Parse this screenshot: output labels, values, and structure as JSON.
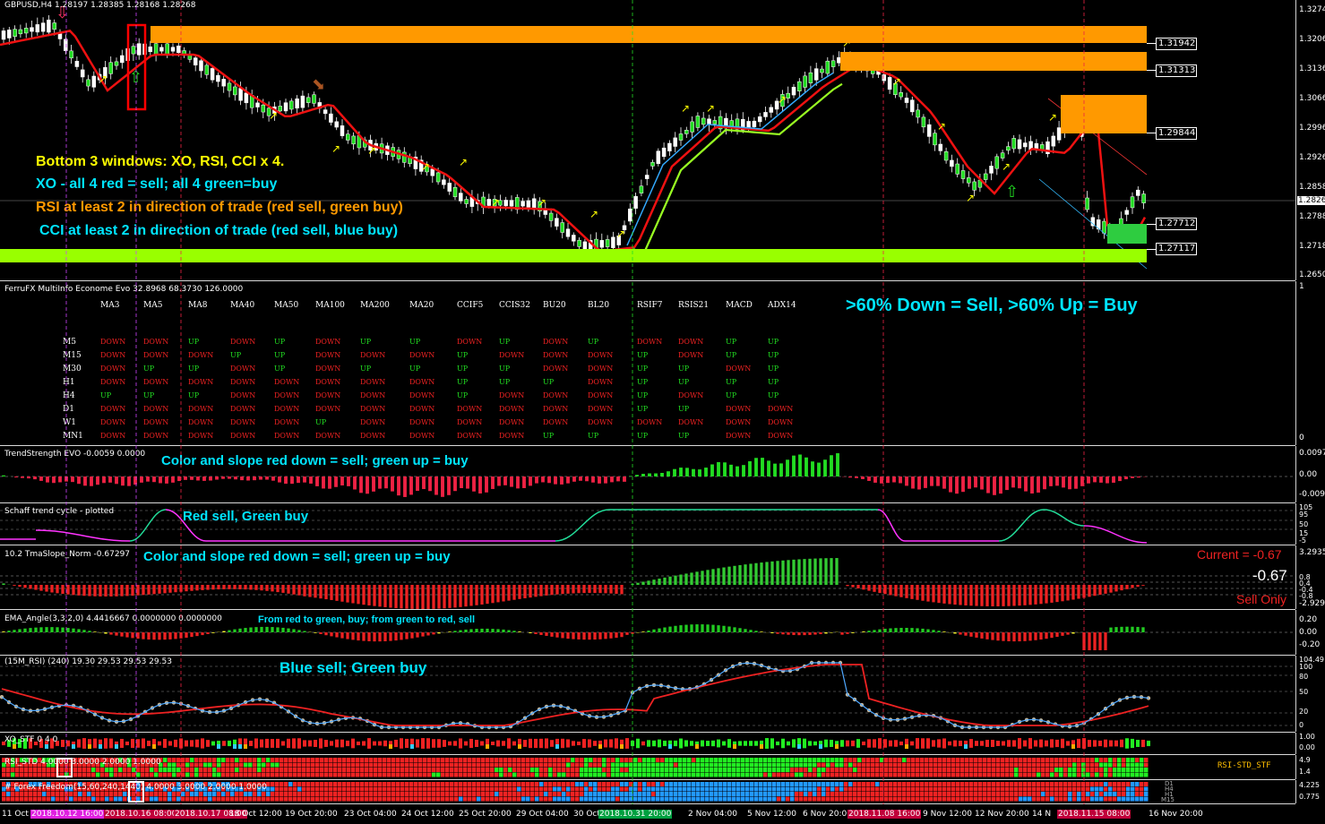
{
  "main": {
    "title": "GBPUSD,H4  1.28197 1.28385 1.28168 1.28268",
    "current_price": "1.2826",
    "price_axis": [
      "1.3274",
      "1.3206",
      "1.3136",
      "1.3066",
      "1.2996",
      "1.2926",
      "1.2858",
      "1.2788",
      "1.2718",
      "1.2650"
    ],
    "levels": [
      "1.31942",
      "1.31313",
      "1.29844",
      "1.27712",
      "1.27117"
    ],
    "notes": [
      "Bottom 3 windows: XO, RSI, CCI x 4.",
      "XO - all 4 red = sell; all 4 green=buy",
      "RSI at least 2 in direction of trade (red sell, green buy)",
      "CCI at least 2 in direction of trade (red sell, blue buy)"
    ]
  },
  "multiinfo": {
    "title": "FerruFX MultiInfo Econome Evo 32.8968 68.3730 126.0000",
    "note": ">60% Down = Sell, >60% Up = Buy",
    "axis_top": "1",
    "axis_bottom": "0",
    "columns": [
      "MA3",
      "MA5",
      "MA8",
      "MA40",
      "MA50",
      "MA100",
      "MA200",
      "MA20",
      "CCIF5",
      "CCIS32",
      "BU20",
      "BL20",
      "RSIF7",
      "RSIS21",
      "MACD",
      "ADX14"
    ],
    "rows": [
      {
        "tf": "M5",
        "cells": [
          "DOWN",
          "DOWN",
          "UP",
          "DOWN",
          "UP",
          "DOWN",
          "UP",
          "UP",
          "DOWN",
          "UP",
          "DOWN",
          "UP",
          "DOWN",
          "DOWN",
          "UP",
          "UP"
        ]
      },
      {
        "tf": "M15",
        "cells": [
          "DOWN",
          "DOWN",
          "DOWN",
          "UP",
          "UP",
          "DOWN",
          "DOWN",
          "DOWN",
          "UP",
          "DOWN",
          "DOWN",
          "DOWN",
          "UP",
          "DOWN",
          "UP",
          "UP"
        ]
      },
      {
        "tf": "M30",
        "cells": [
          "DOWN",
          "UP",
          "UP",
          "DOWN",
          "UP",
          "DOWN",
          "UP",
          "UP",
          "UP",
          "UP",
          "DOWN",
          "DOWN",
          "UP",
          "UP",
          "DOWN",
          "UP"
        ]
      },
      {
        "tf": "H1",
        "cells": [
          "DOWN",
          "DOWN",
          "DOWN",
          "DOWN",
          "DOWN",
          "DOWN",
          "DOWN",
          "DOWN",
          "UP",
          "UP",
          "UP",
          "DOWN",
          "UP",
          "UP",
          "UP",
          "UP"
        ]
      },
      {
        "tf": "H4",
        "cells": [
          "UP",
          "UP",
          "UP",
          "DOWN",
          "DOWN",
          "DOWN",
          "DOWN",
          "DOWN",
          "UP",
          "DOWN",
          "DOWN",
          "DOWN",
          "UP",
          "DOWN",
          "UP",
          "UP"
        ]
      },
      {
        "tf": "D1",
        "cells": [
          "DOWN",
          "DOWN",
          "DOWN",
          "DOWN",
          "DOWN",
          "DOWN",
          "DOWN",
          "DOWN",
          "DOWN",
          "DOWN",
          "DOWN",
          "DOWN",
          "UP",
          "UP",
          "DOWN",
          "DOWN"
        ]
      },
      {
        "tf": "W1",
        "cells": [
          "DOWN",
          "DOWN",
          "DOWN",
          "DOWN",
          "DOWN",
          "UP",
          "DOWN",
          "DOWN",
          "DOWN",
          "DOWN",
          "DOWN",
          "DOWN",
          "DOWN",
          "DOWN",
          "DOWN",
          "DOWN"
        ]
      },
      {
        "tf": "MN1",
        "cells": [
          "DOWN",
          "DOWN",
          "DOWN",
          "DOWN",
          "DOWN",
          "DOWN",
          "DOWN",
          "DOWN",
          "DOWN",
          "DOWN",
          "UP",
          "UP",
          "UP",
          "UP",
          "DOWN",
          "DOWN"
        ]
      }
    ]
  },
  "trend": {
    "title": "TrendStrength EVO -0.0059 0.0000",
    "note": "Color and slope red down = sell; green up = buy",
    "axis": [
      "0.0097",
      "0.00",
      "-0.0094"
    ]
  },
  "schaff": {
    "title": "Schaff trend cycle - plotted",
    "note": "Red sell, Green buy",
    "axis": [
      "105",
      "95",
      "50",
      "15",
      "-5"
    ]
  },
  "tma": {
    "title": "10.2 TmaSlope_Norm -0.67297",
    "note": "Color and slope red down = sell; green up = buy",
    "current_label": "Current = -0.67",
    "value_label": "-0.67",
    "signal_label": "Sell Only",
    "axis": [
      "3.2935",
      "0.8",
      "0.4",
      "-0.4",
      "-0.8",
      "-2.9291"
    ]
  },
  "ema": {
    "title": "EMA_Angle(3,3,2,0) 4.4416667 0.0000000 0.0000000",
    "note": "From red to green, buy; from green to red, sell",
    "axis": [
      "0.20",
      "0.00",
      "-0.20"
    ]
  },
  "rsi": {
    "title": "(15M_RSI) (240) 19.30 29.53 29.53 29.53",
    "note": "Blue sell; Green buy",
    "axis": [
      "104.49",
      "100",
      "80",
      "50",
      "20",
      "0"
    ]
  },
  "xo": {
    "title": "XO_STF 0 4 0",
    "axis": [
      "1.00",
      "0.00"
    ]
  },
  "rsistd": {
    "title": "RSI_STD 4.0000 3.0000 2.0000 1.0000",
    "label": "RSI-STD_STF",
    "axis": [
      "4.9",
      "1.4"
    ]
  },
  "cci": {
    "title": "# Forex Freedom(15,60,240,1440) 4.0000 3.0000 2.0000 1.0000",
    "axis": [
      "4.225",
      "0.775"
    ],
    "tf_labels": [
      "D1",
      "H4",
      "H1",
      "M15"
    ]
  },
  "xaxis": [
    {
      "t": "11 Oct 2018",
      "c": ""
    },
    {
      "t": "2018.10.12 16:00",
      "c": "hl"
    },
    {
      "t": "2018.10.16 08:00",
      "c": "hr"
    },
    {
      "t": "2018.10.17 08:00",
      "c": "hr"
    },
    {
      "t": "18 Oct 12:00",
      "c": ""
    },
    {
      "t": "19 Oct 20:00",
      "c": ""
    },
    {
      "t": "23 Oct 04:00",
      "c": ""
    },
    {
      "t": "24 Oct 12:00",
      "c": ""
    },
    {
      "t": "25 Oct 20:00",
      "c": ""
    },
    {
      "t": "29 Oct 04:00",
      "c": ""
    },
    {
      "t": "30 Oct",
      "c": ""
    },
    {
      "t": "2018.10.31 20:00",
      "c": "hg"
    },
    {
      "t": "2 Nov 04:00",
      "c": ""
    },
    {
      "t": "5 Nov 12:00",
      "c": ""
    },
    {
      "t": "6 Nov 20:00",
      "c": ""
    },
    {
      "t": "2018.11.08 16:00",
      "c": "hr"
    },
    {
      "t": "9 Nov 12:00",
      "c": ""
    },
    {
      "t": "12 Nov 20:00",
      "c": ""
    },
    {
      "t": "14 N",
      "c": ""
    },
    {
      "t": "2018.11.15 08:00",
      "c": "hr"
    },
    {
      "t": "16 Nov 20:00",
      "c": ""
    }
  ],
  "colors": {
    "up": "#22dd22",
    "down": "#ee2222",
    "zone_orange": "#ff9900",
    "zone_green": "#99ff00",
    "accent_cyan": "#00e5ff",
    "note_yellow": "#ffff00"
  }
}
